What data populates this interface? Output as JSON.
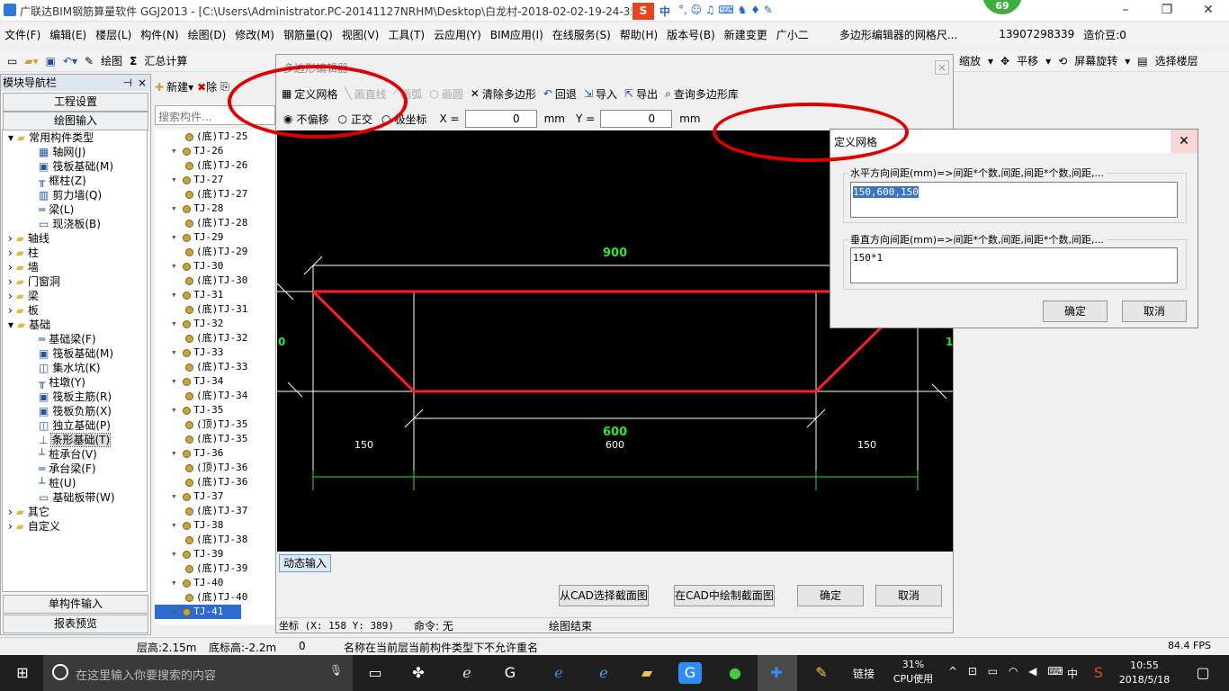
{
  "title_bar": {
    "title": "广联达BIM钢筋算量软件 GGJ2013 - [C:\\Users\\Administrator.PC-20141127NRHM\\Desktop\\白龙村-2018-02-02-19-24-35",
    "ime": "中",
    "badge_count": "69"
  },
  "menu": [
    "文件(F)",
    "编辑(E)",
    "楼层(L)",
    "构件(N)",
    "绘图(D)",
    "修改(M)",
    "钢筋量(Q)",
    "视图(V)",
    "工具(T)",
    "云应用(Y)",
    "BIM应用(I)",
    "在线服务(S)",
    "帮助(H)",
    "版本号(B)",
    "新建变更",
    "广小二",
    "多边形编辑器的网格尺...",
    "13907298339",
    "造价豆:0"
  ],
  "toolbar": {
    "draw": "绘图",
    "sum": "汇总计算",
    "zoom": "缩放",
    "pan": "平移",
    "rotate": "屏幕旋转",
    "select_floor": "选择楼层"
  },
  "nav": {
    "title": "模块导航栏",
    "pin": "♀",
    "close": "×",
    "project_settings": "工程设置",
    "drawing_input": "绘图输入",
    "single_input": "单构件输入",
    "report_preview": "报表预览",
    "tree": [
      {
        "label": "常用构件类型",
        "level": 0,
        "expand": "−",
        "icon": "folder"
      },
      {
        "label": "轴网(J)",
        "level": 1,
        "icon": "axis"
      },
      {
        "label": "筏板基础(M)",
        "level": 1,
        "icon": "raft"
      },
      {
        "label": "框柱(Z)",
        "level": 1,
        "icon": "column"
      },
      {
        "label": "剪力墙(Q)",
        "level": 1,
        "icon": "wall"
      },
      {
        "label": "梁(L)",
        "level": 1,
        "icon": "beam"
      },
      {
        "label": "现浇板(B)",
        "level": 1,
        "icon": "slab"
      },
      {
        "label": "轴线",
        "level": 0,
        "expand": "+",
        "icon": "folder"
      },
      {
        "label": "柱",
        "level": 0,
        "expand": "+",
        "icon": "folder"
      },
      {
        "label": "墙",
        "level": 0,
        "expand": "+",
        "icon": "folder"
      },
      {
        "label": "门窗洞",
        "level": 0,
        "expand": "+",
        "icon": "folder"
      },
      {
        "label": "梁",
        "level": 0,
        "expand": "+",
        "icon": "folder"
      },
      {
        "label": "板",
        "level": 0,
        "expand": "+",
        "icon": "folder"
      },
      {
        "label": "基础",
        "level": 0,
        "expand": "−",
        "icon": "folder"
      },
      {
        "label": "基础梁(F)",
        "level": 1,
        "icon": "beam"
      },
      {
        "label": "筏板基础(M)",
        "level": 1,
        "icon": "raft"
      },
      {
        "label": "集水坑(K)",
        "level": 1,
        "icon": "pit"
      },
      {
        "label": "柱墩(Y)",
        "level": 1,
        "icon": "column"
      },
      {
        "label": "筏板主筋(R)",
        "level": 1,
        "icon": "raft"
      },
      {
        "label": "筏板负筋(X)",
        "level": 1,
        "icon": "raft"
      },
      {
        "label": "独立基础(P)",
        "level": 1,
        "icon": "pit"
      },
      {
        "label": "条形基础(T)",
        "level": 1,
        "icon": "strip",
        "selected": true
      },
      {
        "label": "桩承台(V)",
        "level": 1,
        "icon": "pile"
      },
      {
        "label": "承台梁(F)",
        "level": 1,
        "icon": "beam"
      },
      {
        "label": "桩(U)",
        "level": 1,
        "icon": "pile"
      },
      {
        "label": "基础板带(W)",
        "level": 1,
        "icon": "slab"
      },
      {
        "label": "其它",
        "level": 0,
        "expand": "+",
        "icon": "folder"
      },
      {
        "label": "自定义",
        "level": 0,
        "expand": "+",
        "icon": "folder"
      }
    ]
  },
  "component_panel": {
    "new": "新建",
    "delete": "除",
    "search_placeholder": "搜索构件...",
    "items": [
      {
        "label": "(底)TJ-25",
        "sub": true
      },
      {
        "label": "TJ-26",
        "sub": false
      },
      {
        "label": "(底)TJ-26",
        "sub": true
      },
      {
        "label": "TJ-27",
        "sub": false
      },
      {
        "label": "(底)TJ-27",
        "sub": true
      },
      {
        "label": "TJ-28",
        "sub": false
      },
      {
        "label": "(底)TJ-28",
        "sub": true
      },
      {
        "label": "TJ-29",
        "sub": false
      },
      {
        "label": "(底)TJ-29",
        "sub": true
      },
      {
        "label": "TJ-30",
        "sub": false
      },
      {
        "label": "(底)TJ-30",
        "sub": true
      },
      {
        "label": "TJ-31",
        "sub": false
      },
      {
        "label": "(底)TJ-31",
        "sub": true
      },
      {
        "label": "TJ-32",
        "sub": false
      },
      {
        "label": "(底)TJ-32",
        "sub": true
      },
      {
        "label": "TJ-33",
        "sub": false
      },
      {
        "label": "(底)TJ-33",
        "sub": true
      },
      {
        "label": "TJ-34",
        "sub": false
      },
      {
        "label": "(底)TJ-34",
        "sub": true
      },
      {
        "label": "TJ-35",
        "sub": false
      },
      {
        "label": "(顶)TJ-35",
        "sub": true
      },
      {
        "label": "(底)TJ-35",
        "sub": true
      },
      {
        "label": "TJ-36",
        "sub": false
      },
      {
        "label": "(顶)TJ-36",
        "sub": true
      },
      {
        "label": "(底)TJ-36",
        "sub": true
      },
      {
        "label": "TJ-37",
        "sub": false
      },
      {
        "label": "(底)TJ-37",
        "sub": true
      },
      {
        "label": "TJ-38",
        "sub": false
      },
      {
        "label": "(底)TJ-38",
        "sub": true
      },
      {
        "label": "TJ-39",
        "sub": false
      },
      {
        "label": "(底)TJ-39",
        "sub": true
      },
      {
        "label": "TJ-40",
        "sub": false
      },
      {
        "label": "(底)TJ-40",
        "sub": true
      },
      {
        "label": "TJ-41",
        "sub": false,
        "selected": true
      }
    ]
  },
  "poly_editor": {
    "title": "多边形编辑器",
    "define_grid": "定义网格",
    "draw_line": "画直线",
    "draw_arc": "画弧",
    "draw_circle": "画圆",
    "clear_polygon": "清除多边形",
    "undo": "回退",
    "import": "导入",
    "export": "导出",
    "query_library": "查询多边形库",
    "opt_no_offset": "不偏移",
    "opt_ortho": "正交",
    "opt_polar": "极坐标",
    "x_label": "X =",
    "y_label": "Y =",
    "x_value": "0",
    "y_value": "0",
    "unit": "mm",
    "dynamic_input": "动态输入",
    "select_from_cad": "从CAD选择截面图",
    "draw_in_cad": "在CAD中绘制截面图",
    "ok": "确定",
    "cancel": "取消",
    "coord_status": "坐标 (X: 158 Y: 389)",
    "command": "命令: 无",
    "draw_end": "绘图结束",
    "dim_top": "900",
    "dim_bottom": "600",
    "dim_left_label": "0",
    "dim_right_label": "1",
    "grid_labels": [
      "150",
      "600",
      "150"
    ]
  },
  "define_grid_dialog": {
    "title": "定义网格",
    "horizontal_label": "水平方向间距(mm)=>间距*个数,间距,间距*个数,间距,...",
    "horizontal_value": "150,600,150",
    "vertical_label": "垂直方向间距(mm)=>间距*个数,间距,间距*个数,间距,...",
    "vertical_value": "150*1",
    "ok": "确定",
    "cancel": "取消"
  },
  "status_bar": {
    "floor_height": "层高:2.15m",
    "base_height": "底标高:-2.2m",
    "zero": "0",
    "message": "名称在当前层当前构件类型下不允许重名",
    "fps": "84.4 FPS"
  },
  "taskbar": {
    "search_placeholder": "在这里输入你要搜索的内容",
    "link": "链接",
    "cpu_percent": "31%",
    "cpu_label": "CPU使用",
    "ime": "中",
    "time": "10:55",
    "date": "2018/5/18"
  },
  "colors": {
    "polygon": "#ff2020",
    "dimension": "#2ee62e",
    "grid": "#ffffff",
    "annotation": "#e00000"
  }
}
